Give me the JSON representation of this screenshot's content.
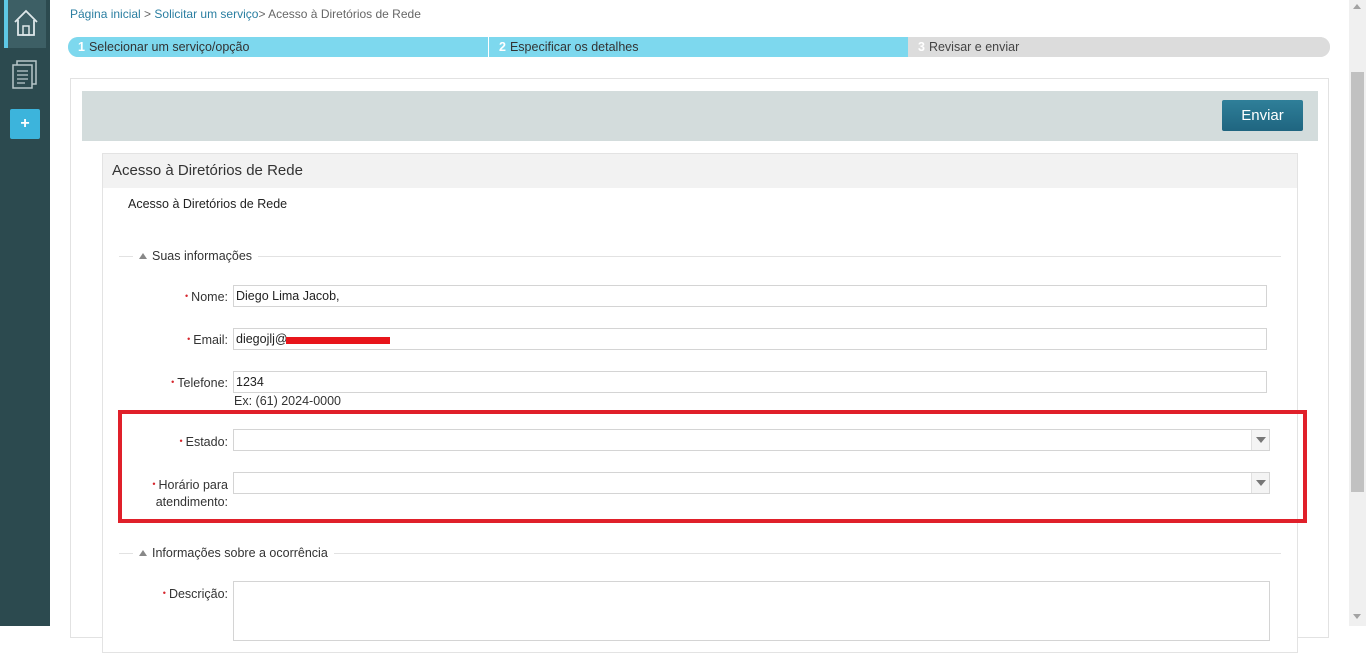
{
  "breadcrumb": {
    "home": "Página inicial",
    "sep1": " > ",
    "service": "Solicitar um serviço",
    "sep2": "> ",
    "current": "Acesso à Diretórios de Rede"
  },
  "steps": [
    {
      "num": "1",
      "label": "Selecionar um serviço/opção",
      "active": true
    },
    {
      "num": "2",
      "label": "Especificar os detalhes",
      "active": true
    },
    {
      "num": "3",
      "label": "Revisar e enviar",
      "active": false
    }
  ],
  "toolbar": {
    "send_label": "Enviar"
  },
  "form": {
    "title": "Acesso à Diretórios de Rede",
    "subtitle": "Acesso à Diretórios de Rede",
    "section_info": "Suas informações",
    "section_occurrence": "Informações sobre a ocorrência",
    "fields": {
      "name": {
        "label": "Nome:",
        "value": "Diego Lima Jacob,"
      },
      "email": {
        "label": "Email:",
        "value": "diegojlj@"
      },
      "phone": {
        "label": "Telefone:",
        "value": "1234",
        "hint": "Ex: (61) 2024-0000"
      },
      "state": {
        "label": "Estado:",
        "value": ""
      },
      "schedule": {
        "label_line1": "Horário para",
        "label_line2": "atendimento:",
        "value": ""
      },
      "description": {
        "label": "Descrição:",
        "value": ""
      }
    },
    "required_mark": "•"
  },
  "colors": {
    "rail": "#2c4a4f",
    "step_active": "#7dd8ee",
    "send_button": "#1f6580",
    "highlight": "#e0202a",
    "required": "#d6262d"
  },
  "icons": [
    "home-icon",
    "documents-icon",
    "add-icon",
    "collapse-triangle-icon",
    "dropdown-arrow-icon"
  ]
}
